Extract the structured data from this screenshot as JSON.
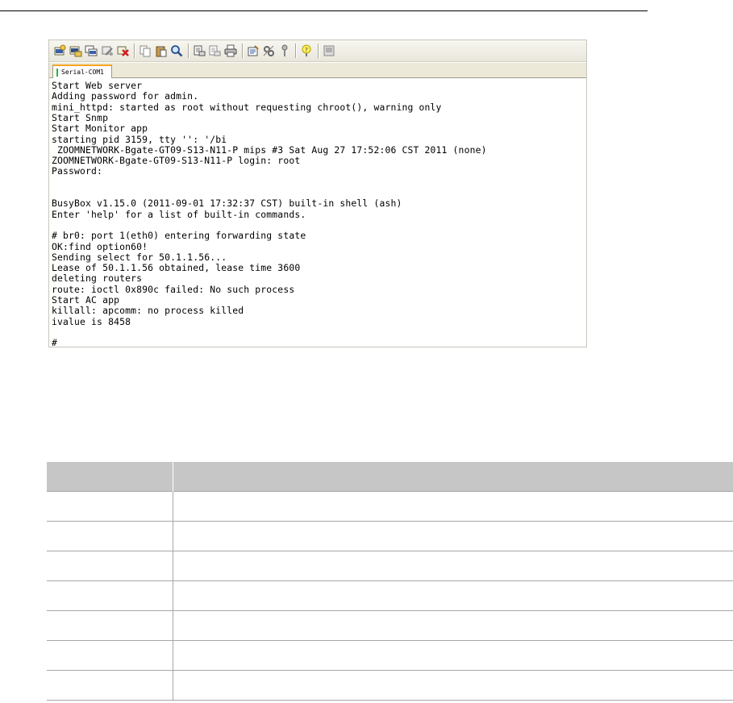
{
  "toolbar": {
    "buttons": [
      {
        "icon": "new-session-icon"
      },
      {
        "icon": "open-session-icon"
      },
      {
        "icon": "duplicate-session-icon"
      },
      {
        "icon": "reconnect-icon"
      },
      {
        "icon": "disconnect-icon"
      },
      {
        "separator": true
      },
      {
        "icon": "copy-icon"
      },
      {
        "icon": "paste-icon"
      },
      {
        "icon": "find-icon"
      },
      {
        "separator": true
      },
      {
        "icon": "print-setup-icon"
      },
      {
        "icon": "print-preview-icon"
      },
      {
        "icon": "print-icon"
      },
      {
        "separator": true
      },
      {
        "icon": "properties-icon"
      },
      {
        "icon": "settings-icon"
      },
      {
        "icon": "keymap-icon"
      },
      {
        "separator": true
      },
      {
        "icon": "help-icon"
      },
      {
        "separator": true
      },
      {
        "icon": "about-icon"
      }
    ]
  },
  "tab": {
    "label": "Serial-COM1",
    "status_color": "#27b43b"
  },
  "console": {
    "lines": [
      "Start Web server",
      "Adding password for admin.",
      "mini_httpd: started as root without requesting chroot(), warning only",
      "Start Snmp",
      "Start Monitor app",
      "starting pid 3159, tty '': '/bi",
      " ZOOMNETWORK-Bgate-GT09-S13-N11-P mips #3 Sat Aug 27 17:52:06 CST 2011 (none)",
      "ZOOMNETWORK-Bgate-GT09-S13-N11-P login: root",
      "Password:",
      "",
      "",
      "BusyBox v1.15.0 (2011-09-01 17:32:37 CST) built-in shell (ash)",
      "Enter 'help' for a list of built-in commands.",
      "",
      "# br0: port 1(eth0) entering forwarding state",
      "OK:find option60!",
      "Sending select for 50.1.1.56...",
      "Lease of 50.1.1.56 obtained, lease time 3600",
      "deleting routers",
      "route: ioctl 0x890c failed: No such process",
      "Start AC app",
      "killall: apcomm: no process killed",
      "ivalue is 8458",
      "",
      "#"
    ]
  },
  "table": {
    "headers": [
      "",
      ""
    ],
    "rows": [
      [
        "",
        ""
      ],
      [
        "",
        ""
      ],
      [
        "",
        ""
      ],
      [
        "",
        ""
      ],
      [
        "",
        ""
      ],
      [
        "",
        ""
      ],
      [
        "",
        ""
      ]
    ]
  },
  "colors": {
    "toolbar_bg": "#ece9d8",
    "tab_accent": "#f5a623",
    "table_header_bg": "#c6c6c6"
  }
}
